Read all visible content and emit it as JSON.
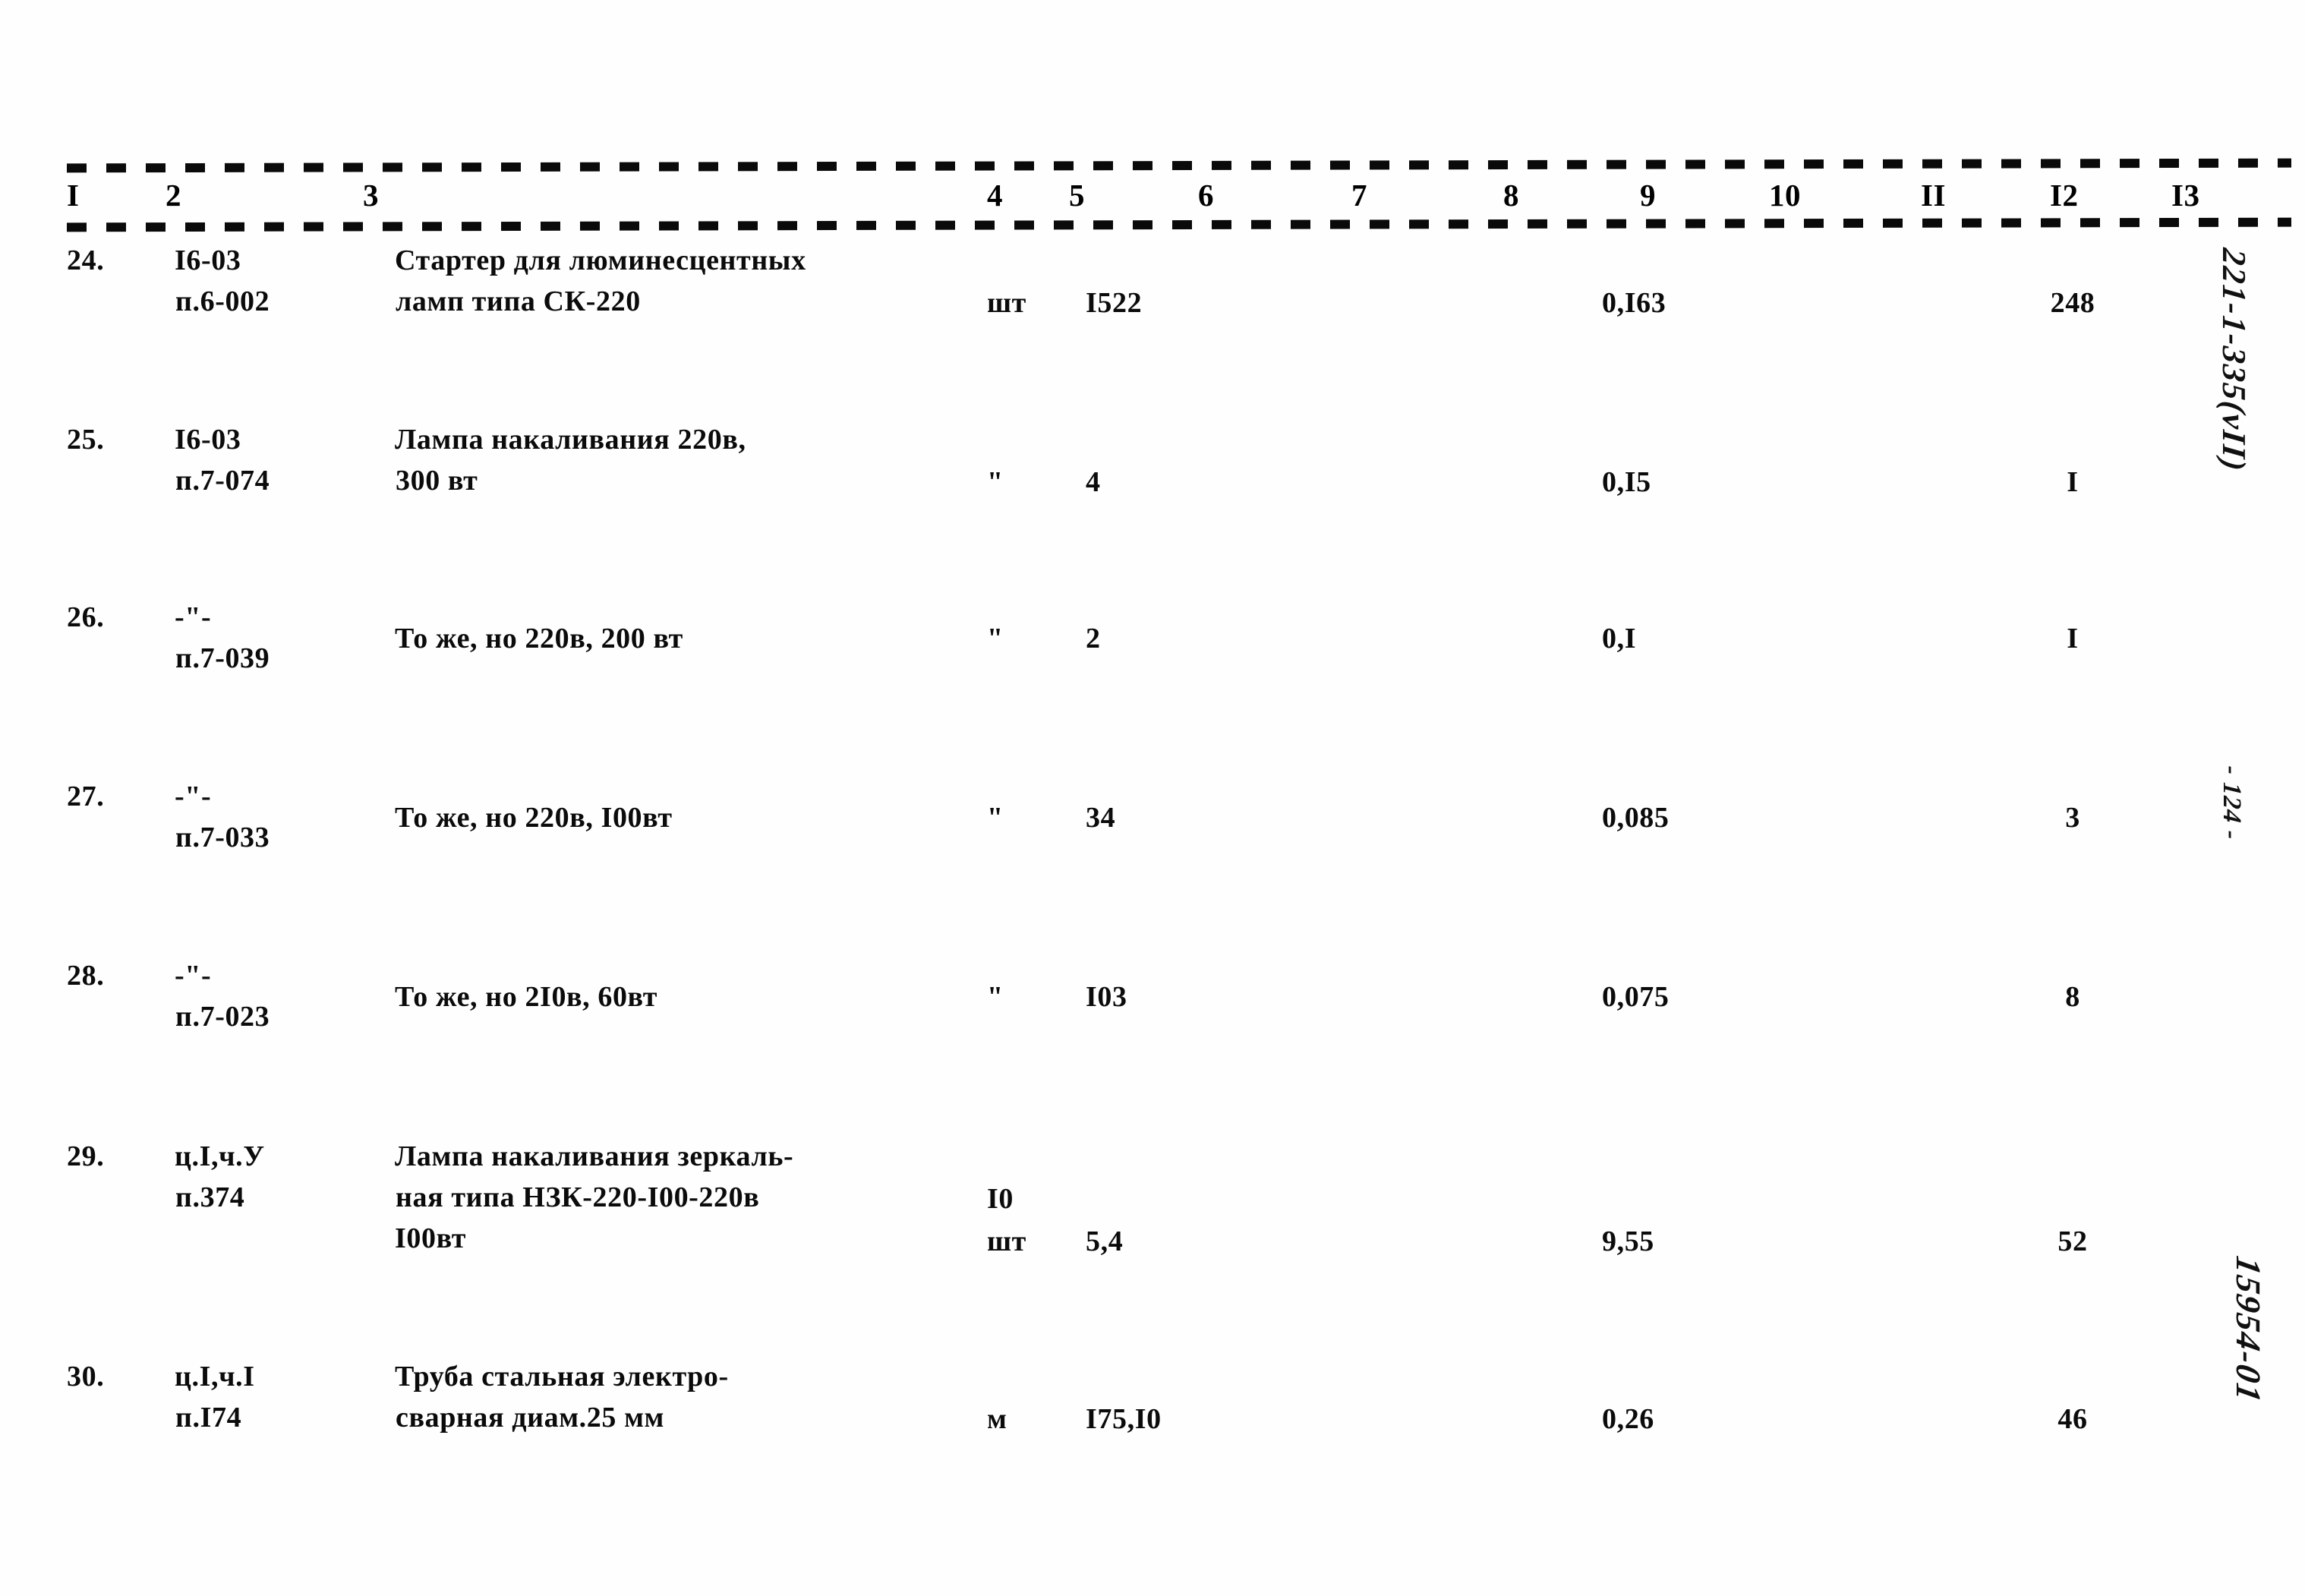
{
  "document": {
    "type": "specification-table",
    "column_headers": [
      "I",
      "2",
      "3",
      "4",
      "5",
      "6",
      "7",
      "8",
      "9",
      "10",
      "II",
      "I2",
      "I3"
    ]
  },
  "margin_notes": {
    "code": "221-1-335(vII)",
    "page": "- 124 -",
    "archive": "15954-01"
  },
  "rows": [
    {
      "num": "24.",
      "code_line1": "I6-03",
      "code_line2": "п.6-002",
      "name_line1": "Стартер для люминесцентных",
      "name_line2": "ламп типа СК-220",
      "name_line3": "",
      "unit": "шт",
      "qty": "I522",
      "col9": "0,I63",
      "col12": "248",
      "extra10": ""
    },
    {
      "num": "25.",
      "code_line1": "I6-03",
      "code_line2": "п.7-074",
      "name_line1": "Лампа накаливания 220в,",
      "name_line2": "300 вт",
      "name_line3": "",
      "unit": "\"",
      "qty": "4",
      "col9": "0,I5",
      "col12": "I",
      "extra10": ""
    },
    {
      "num": "26.",
      "code_line1": "-\"-",
      "code_line2": "п.7-039",
      "name_line1": "То же, но 220в, 200 вт",
      "name_line2": "",
      "name_line3": "",
      "unit": "\"",
      "qty": "2",
      "col9": "0,I",
      "col12": "I",
      "extra10": ""
    },
    {
      "num": "27.",
      "code_line1": "-\"-",
      "code_line2": "п.7-033",
      "name_line1": "То же, но 220в, I00вт",
      "name_line2": "",
      "name_line3": "",
      "unit": "\"",
      "qty": "34",
      "col9": "0,085",
      "col12": "3",
      "extra10": ""
    },
    {
      "num": "28.",
      "code_line1": "-\"-",
      "code_line2": "п.7-023",
      "name_line1": "То же, но 2I0в, 60вт",
      "name_line2": "",
      "name_line3": "",
      "unit": "\"",
      "qty": "I03",
      "col9": "0,075",
      "col12": "8",
      "extra10": ""
    },
    {
      "num": "29.",
      "code_line1": "ц.I,ч.У",
      "code_line2": "п.374",
      "name_line1": "Лампа накаливания зеркаль-",
      "name_line2": "ная типа НЗК-220-I00-220в",
      "name_line3": "I00вт",
      "unit": "шт",
      "qty": "5,4",
      "col9": "9,55",
      "col12": "52",
      "extra10": "I0"
    },
    {
      "num": "30.",
      "code_line1": "ц.I,ч.I",
      "code_line2": "п.I74",
      "name_line1": "Труба стальная электро-",
      "name_line2": "сварная диам.25 мм",
      "name_line3": "",
      "unit": "м",
      "qty": "I75,I0",
      "col9": "0,26",
      "col12": "46",
      "extra10": ""
    }
  ],
  "layout": {
    "header_x": [
      88,
      218,
      478,
      1300,
      1408,
      1578,
      1780,
      1980,
      2160,
      2330,
      2530,
      2700,
      2860
    ],
    "row_tops": [
      0,
      236,
      470,
      706,
      942,
      1180,
      1470
    ],
    "row_name_offsets": [
      0,
      0,
      28,
      28,
      28,
      0,
      0
    ],
    "row_value_offsets": [
      56,
      56,
      28,
      28,
      28,
      112,
      56
    ]
  }
}
